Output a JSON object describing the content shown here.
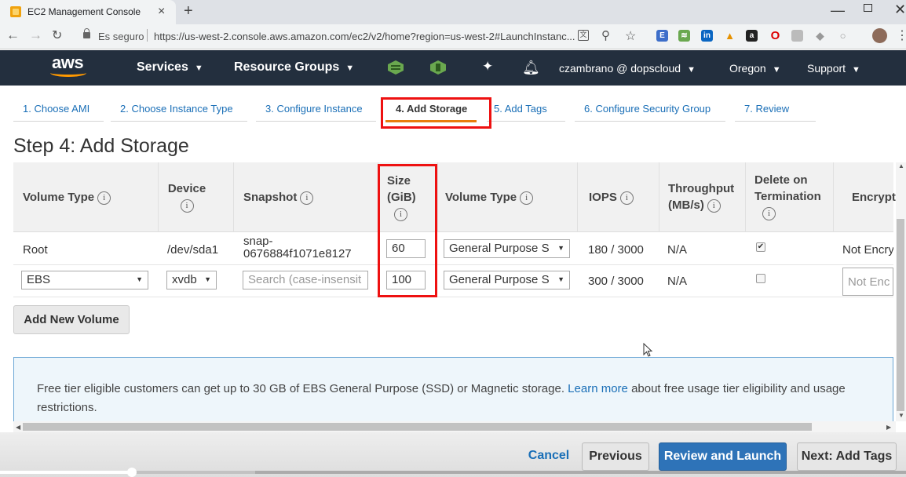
{
  "browser": {
    "tab_title": "EC2 Management Console",
    "tab_close": "×",
    "new_tab": "+",
    "secure_label": "Es seguro",
    "url": "https://us-west-2.console.aws.amazon.com/ec2/v2/home?region=us-west-2#LaunchInstanc...",
    "window_min": "—",
    "window_close": "✕"
  },
  "aws_nav": {
    "logo": "aws",
    "services": "Services",
    "resource_groups": "Resource Groups",
    "account": "czambrano @ dopscloud",
    "region": "Oregon",
    "support": "Support"
  },
  "wizard": {
    "steps": [
      {
        "label": "1. Choose AMI"
      },
      {
        "label": "2. Choose Instance Type"
      },
      {
        "label": "3. Configure Instance"
      },
      {
        "label": "4. Add Storage",
        "active": true
      },
      {
        "label": "5. Add Tags"
      },
      {
        "label": "6. Configure Security Group"
      },
      {
        "label": "7. Review"
      }
    ]
  },
  "page_title": "Step 4: Add Storage",
  "table": {
    "headers": {
      "volume_type": "Volume Type",
      "device": "Device",
      "snapshot": "Snapshot",
      "size_line1": "Size",
      "size_line2": "(GiB)",
      "volume_type2": "Volume Type",
      "iops": "IOPS",
      "throughput_line1": "Throughput",
      "throughput_line2": "(MB/s)",
      "delete_line1": "Delete on",
      "delete_line2": "Termination",
      "encryption": "Encrypt"
    },
    "info_glyph": "i",
    "rows": [
      {
        "volume_type": "Root",
        "device": "/dev/sda1",
        "snapshot_line1": "snap-",
        "snapshot_line2": "0676884f1071e8127",
        "size": "60",
        "volume_type2": "General Purpose S",
        "iops": "180 / 3000",
        "throughput": "N/A",
        "delete_on_termination": true,
        "encryption": "Not Encry"
      },
      {
        "volume_type": "EBS",
        "device": "xvdb",
        "snapshot_placeholder": "Search (case-insensit",
        "size": "100",
        "volume_type2": "General Purpose S",
        "iops": "300 / 3000",
        "throughput": "N/A",
        "delete_on_termination": false,
        "encryption": "Not Enc"
      }
    ]
  },
  "add_volume_button": "Add New Volume",
  "info_box": {
    "text_before": "Free tier eligible customers can get up to 30 GB of EBS General Purpose (SSD) or Magnetic storage.",
    "link": "Learn more",
    "text_after": "about free usage tier eligibility and usage restrictions."
  },
  "footer": {
    "cancel": "Cancel",
    "previous": "Previous",
    "review_launch": "Review and Launch",
    "next": "Next: Add Tags"
  },
  "video_progress": 0.146,
  "colors": {
    "aws_nav_bg": "#232f3e",
    "aws_orange": "#ff9900",
    "link_blue": "#1a6fb7",
    "primary_button": "#2e73b8",
    "highlight_red": "#e11111"
  }
}
